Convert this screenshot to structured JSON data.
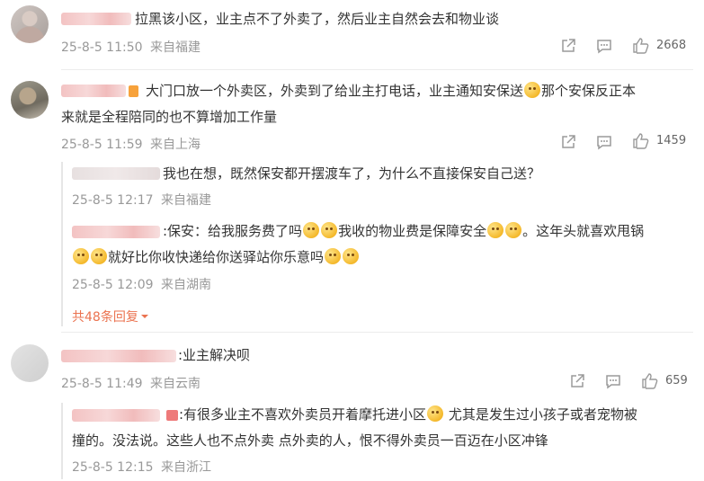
{
  "comments": [
    {
      "text": "拉黑该小区，业主点不了外卖了，然后业主自然会去和物业谈",
      "time": "25-8-5 11:50",
      "location": "来自福建",
      "likes": "2668"
    },
    {
      "text_line1": "大门口放一个外卖区，外卖到了给业主打电话，业主通知安保送",
      "text_line1b": "那个安保反正本",
      "text_line2": "来就是全程陪同的也不算增加工作量",
      "time": "25-8-5 11:59",
      "location": "来自上海",
      "likes": "1459",
      "replies": [
        {
          "text": "我也在想，既然保安都开摆渡车了，为什么不直接保安自己送？",
          "time": "25-8-5 12:17",
          "location": "来自福建"
        },
        {
          "text_a": ":保安：给我服务费了吗",
          "text_b": "我收的物业费是保障安全",
          "text_c": "。这年头就喜欢甩锅",
          "text_d": "就好比你收快递给你送驿站你乐意吗",
          "time": "25-8-5 12:09",
          "location": "来自湖南"
        }
      ],
      "more_replies": "共48条回复"
    },
    {
      "text": ":业主解决呗",
      "time": "25-8-5 11:49",
      "location": "来自云南",
      "likes": "659",
      "replies": [
        {
          "text_a": ":有很多业主不喜欢外卖员开着摩托进小区",
          "text_b": " 尤其是发生过小孩子或者宠物被",
          "text_line2": "撞的。没法说。这些人也不点外卖  点外卖的人，恨不得外卖员一百迈在小区冲锋",
          "time": "25-8-5 12:15",
          "location": "来自浙江"
        }
      ]
    }
  ],
  "colors": {
    "accent": "#eb7350",
    "meta": "#999999",
    "text": "#333333"
  },
  "icons": [
    "share-icon",
    "comment-icon",
    "like-icon",
    "chevron-down-icon",
    "emoji-icon"
  ]
}
